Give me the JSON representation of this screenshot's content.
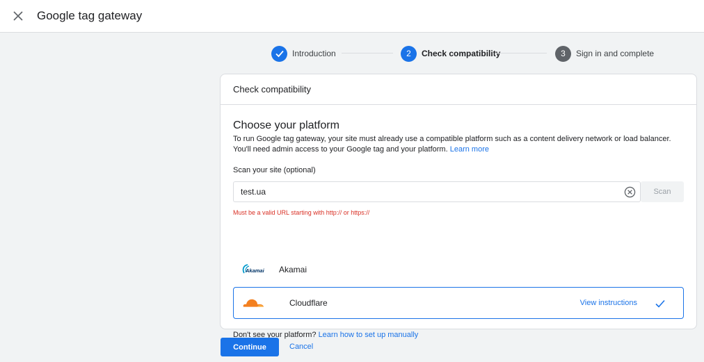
{
  "header": {
    "title": "Google tag gateway",
    "close_icon": "close-icon"
  },
  "stepper": {
    "steps": [
      {
        "number": "",
        "label": "Introduction",
        "state": "done"
      },
      {
        "number": "2",
        "label": "Check compatibility",
        "state": "active"
      },
      {
        "number": "3",
        "label": "Sign in and complete",
        "state": "pending"
      }
    ]
  },
  "card": {
    "header": "Check compatibility",
    "heading": "Choose your platform",
    "description": "To run Google tag gateway, your site must already use a compatible platform such as a content delivery network or load balancer. You'll need admin access to your Google tag and your platform.",
    "learn_more": "Learn more",
    "scan_label": "Scan your site (optional)",
    "scan_input_value": "test.ua",
    "scan_button": "Scan",
    "error": "Must be a valid URL starting with http:// or https://",
    "platforms": [
      {
        "name": "Akamai",
        "logo_text": "Akamai",
        "selected": false
      },
      {
        "name": "Cloudflare",
        "selected": true,
        "action": "View instructions"
      }
    ],
    "dont_see": "Don't see your platform?",
    "manual_link": "Learn how to set up manually"
  },
  "footer": {
    "continue": "Continue",
    "cancel": "Cancel"
  },
  "colors": {
    "accent": "#1a73e8",
    "error": "#d93025",
    "pending_step": "#5f6368",
    "cloudflare_orange": "#f38020"
  }
}
